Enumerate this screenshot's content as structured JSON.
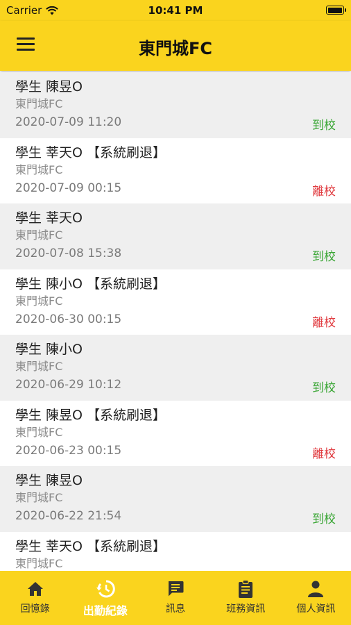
{
  "status_bar": {
    "carrier": "Carrier",
    "time": "10:41 PM"
  },
  "header": {
    "title": "東門城FC"
  },
  "records": [
    {
      "name": "學生 陳昱O",
      "school": "東門城FC",
      "datetime": "2020-07-09 11:20",
      "status": "到校",
      "status_color": "#3aa635"
    },
    {
      "name": "學生 莘天O 【系統刷退】",
      "school": "東門城FC",
      "datetime": "2020-07-09 00:15",
      "status": "離校",
      "status_color": "#e0393e"
    },
    {
      "name": "學生 莘天O",
      "school": "東門城FC",
      "datetime": "2020-07-08 15:38",
      "status": "到校",
      "status_color": "#3aa635"
    },
    {
      "name": "學生 陳小O 【系統刷退】",
      "school": "東門城FC",
      "datetime": "2020-06-30 00:15",
      "status": "離校",
      "status_color": "#e0393e"
    },
    {
      "name": "學生 陳小O",
      "school": "東門城FC",
      "datetime": "2020-06-29 10:12",
      "status": "到校",
      "status_color": "#3aa635"
    },
    {
      "name": "學生 陳昱O 【系統刷退】",
      "school": "東門城FC",
      "datetime": "2020-06-23 00:15",
      "status": "離校",
      "status_color": "#e0393e"
    },
    {
      "name": "學生 陳昱O",
      "school": "東門城FC",
      "datetime": "2020-06-22 21:54",
      "status": "到校",
      "status_color": "#3aa635"
    },
    {
      "name": "學生 莘天O 【系統刷退】",
      "school": "東門城FC",
      "datetime": "",
      "status": "",
      "status_color": "#e0393e"
    }
  ],
  "tabs": [
    {
      "label": "回憶錄",
      "icon": "home-icon",
      "active": false
    },
    {
      "label": "出勤紀錄",
      "icon": "history-icon",
      "active": true
    },
    {
      "label": "訊息",
      "icon": "message-icon",
      "active": false
    },
    {
      "label": "班務資訊",
      "icon": "clipboard-icon",
      "active": false
    },
    {
      "label": "個人資訊",
      "icon": "person-icon",
      "active": false
    }
  ]
}
